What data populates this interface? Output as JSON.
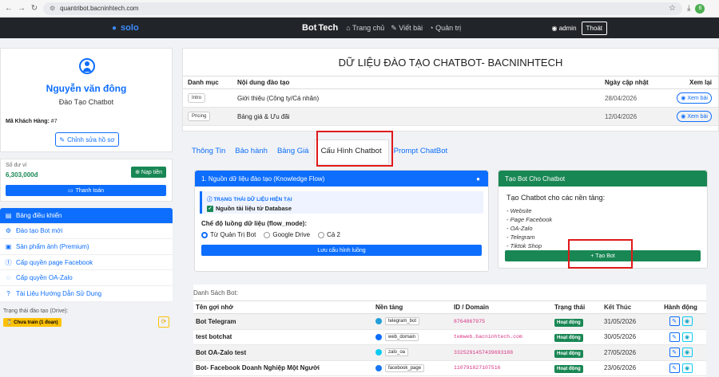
{
  "browser": {
    "url": "quantribot.bacninhtech.com",
    "profile_letter": "6"
  },
  "topnav": {
    "brand_a": "solo",
    "brand_b": "Bot",
    "brand_c": "Tech",
    "links": [
      "Trang chủ",
      "Viết bài",
      "Quản trị"
    ],
    "user": "admin",
    "logout": "Thoát"
  },
  "profile": {
    "name": "Nguyễn văn đông",
    "role": "Đào Tạo Chatbot",
    "code_label": "Mã Khách Hàng:",
    "code_value": "#7",
    "edit_button": "Chỉnh sửa hồ sơ"
  },
  "wallet": {
    "label": "Số dư ví",
    "amount": "6,303,000đ",
    "topup": "Nạp tiền",
    "pay": "Thanh toán"
  },
  "menu": [
    {
      "label": "Bảng điều khiển",
      "icon": "dashboard-icon",
      "glyph": "▤"
    },
    {
      "label": "Đào tạo Bot mới",
      "icon": "robot-icon",
      "glyph": "⚙"
    },
    {
      "label": "Sản phẩm ảnh (Premium)",
      "icon": "image-icon",
      "glyph": "▣"
    },
    {
      "label": "Cấp quyền page Facebook",
      "icon": "facebook-icon",
      "glyph": "ⓕ"
    },
    {
      "label": "Cấp quyền OA-Zalo",
      "icon": "chat-icon",
      "glyph": "◌"
    },
    {
      "label": "Tài Liệu Hướng Dẫn Sử Dụng",
      "icon": "help-icon",
      "glyph": "?"
    }
  ],
  "drive": {
    "label": "Trạng thái đào tạo (Drive):",
    "badge": "Chưa train (1 đoạn)"
  },
  "kb": {
    "title": "DỮ LIỆU ĐÀO TẠO CHATBOT- BACNINHTECH",
    "headers": {
      "category": "Danh mục",
      "content": "Nội dung đào tạo",
      "updated": "Ngày cập nhật",
      "view": "Xem lại"
    },
    "rows": [
      {
        "tag": "Intro",
        "content": "Giới thiệu (Công ty/Cá nhân)",
        "date": "28/04/2026",
        "view": "Xem bài"
      },
      {
        "tag": "Pricing",
        "content": "Bảng giá & Ưu đãi",
        "date": "12/04/2026",
        "view": "Xem bài"
      }
    ]
  },
  "tabs": [
    "Thông Tin",
    "Bảo hành",
    "Bảng Giá",
    "Cấu Hình Chatbot",
    "Prompt ChatBot"
  ],
  "knowledge": {
    "header": "1. Nguồn dữ liệu đào tạo (Knowledge Flow)",
    "status_title": "TRẠNG THÁI DỮ LIỆU HIỆN TẠI",
    "status_value": "Nguồn tài liệu từ Database",
    "flow_label": "Chế độ luồng dữ liệu (flow_mode):",
    "options": [
      "Từ Quản Trị Bot",
      "Google Drive",
      "Cả 2"
    ],
    "save": "Lưu cấu hình luồng"
  },
  "create_bot": {
    "header": "Tạo Bot Cho Chatbot",
    "subtitle": "Tạo Chatbot cho các nền tảng:",
    "platforms": [
      "- Website",
      "- Page Facebook",
      "- OA-Zalo",
      "- Telegram",
      "- Tiktok Shop"
    ],
    "button": "+ Tạo Bot"
  },
  "bots": {
    "title": "Danh Sách Bot:",
    "headers": {
      "name": "Tên gợi nhớ",
      "platform": "Nền tảng",
      "id": "ID / Domain",
      "status": "Trạng thái",
      "end": "Kết Thúc",
      "actions": "Hành động"
    },
    "rows": [
      {
        "name": "Bot Telegram",
        "platform": "telegram_bot",
        "pcolor": "#229ed9",
        "id": "8764867975",
        "status": "Hoạt động",
        "end": "31/05/2026"
      },
      {
        "name": "test botchat",
        "platform": "web_domain",
        "pcolor": "#0d6efd",
        "id": "temweb.bacninhtech.com",
        "status": "Hoạt động",
        "end": "30/05/2026"
      },
      {
        "name": "Bot OA-Zalo test",
        "platform": "zalo_oa",
        "pcolor": "#0dcaf0",
        "id": "3325291457439693188",
        "status": "Hoạt động",
        "end": "27/05/2026"
      },
      {
        "name": "Bot- Facebook Doanh Nghiệp Một Người",
        "platform": "facebook_page",
        "pcolor": "#1877f2",
        "id": "110791827107516",
        "status": "Hoạt động",
        "end": "23/06/2026"
      }
    ]
  },
  "colors": {
    "primary": "#0d6efd",
    "success": "#198754",
    "warning": "#ffc107",
    "highlight": "#e01919"
  }
}
